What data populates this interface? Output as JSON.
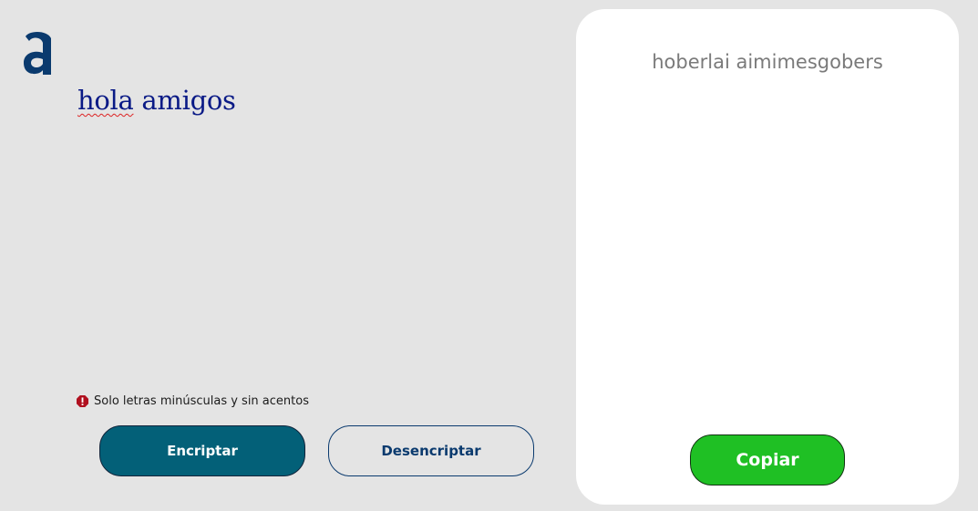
{
  "logo": {
    "letter": "a",
    "color": "#0a3a6e"
  },
  "input": {
    "text_word1": "hola",
    "text_rest": " amigos"
  },
  "hint": {
    "icon": "exclamation-icon",
    "text": "Solo letras minúsculas y sin acentos"
  },
  "buttons": {
    "encrypt_label": "Encriptar",
    "decrypt_label": "Desencriptar",
    "copy_label": "Copiar"
  },
  "output": {
    "text": "hoberlai aimimesgobers"
  },
  "colors": {
    "background": "#e4e4e4",
    "encrypt_button": "#036078",
    "copy_button": "#1fc024",
    "input_text": "#0a1a86",
    "output_text": "#7a7a7a"
  }
}
